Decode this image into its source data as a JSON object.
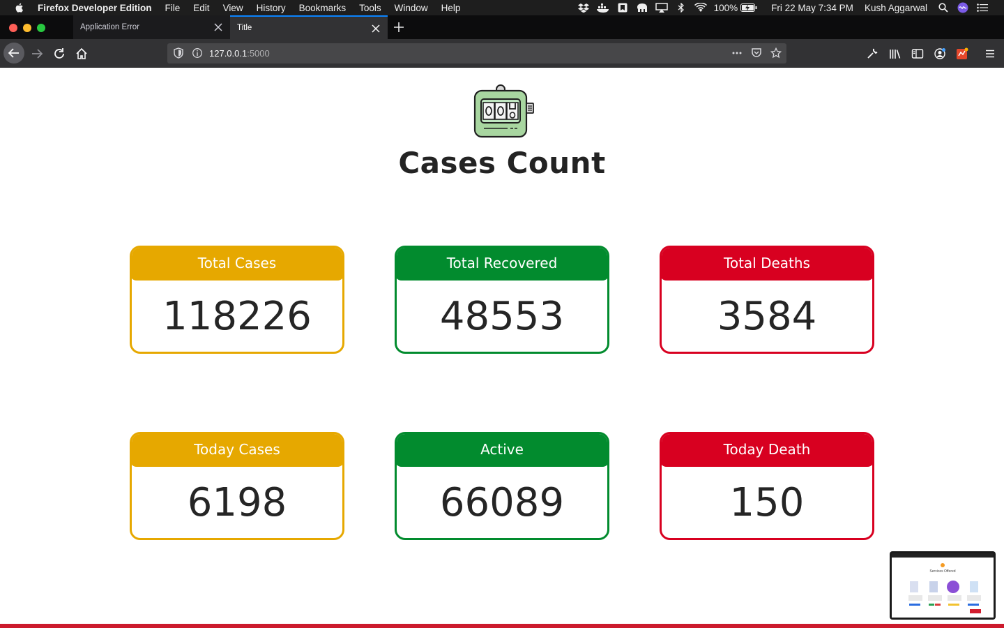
{
  "menubar": {
    "app_name": "Firefox Developer Edition",
    "items": [
      "File",
      "Edit",
      "View",
      "History",
      "Bookmarks",
      "Tools",
      "Window",
      "Help"
    ],
    "battery": "100%",
    "datetime": "Fri 22 May  7:34 PM",
    "user": "Kush Aggarwal"
  },
  "tabs": [
    {
      "label": "Application Error"
    },
    {
      "label": "Title"
    }
  ],
  "urlbar": {
    "host": "127.0.0.1",
    "port": ":5000"
  },
  "page": {
    "title": "Cases Count",
    "cards": [
      {
        "label": "Total Cases",
        "value": "118226",
        "color": "#e6a800"
      },
      {
        "label": "Total Recovered",
        "value": "48553",
        "color": "#028b2e"
      },
      {
        "label": "Total Deaths",
        "value": "3584",
        "color": "#d80020"
      },
      {
        "label": "Today Cases",
        "value": "6198",
        "color": "#e6a800"
      },
      {
        "label": "Active",
        "value": "66089",
        "color": "#028b2e"
      },
      {
        "label": "Today Death",
        "value": "150",
        "color": "#d80020"
      }
    ]
  },
  "thumbnail": {
    "title": "Services Offered"
  }
}
